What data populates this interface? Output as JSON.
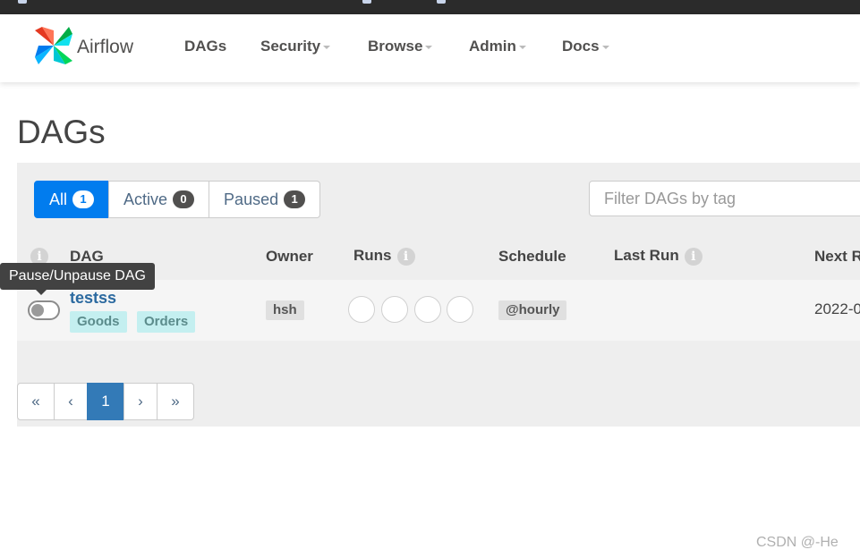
{
  "navbar": {
    "brand": "Airflow",
    "items": [
      {
        "label": "DAGs",
        "dropdown": false
      },
      {
        "label": "Security",
        "dropdown": true
      },
      {
        "label": "Browse",
        "dropdown": true
      },
      {
        "label": "Admin",
        "dropdown": true
      },
      {
        "label": "Docs",
        "dropdown": true
      }
    ]
  },
  "page": {
    "title": "DAGs"
  },
  "filters": {
    "tabs": [
      {
        "label": "All",
        "count": "1",
        "active": true
      },
      {
        "label": "Active",
        "count": "0",
        "active": false
      },
      {
        "label": "Paused",
        "count": "1",
        "active": false
      }
    ],
    "tag_placeholder": "Filter DAGs by tag"
  },
  "table": {
    "headers": {
      "dag": "DAG",
      "owner": "Owner",
      "runs": "Runs",
      "schedule": "Schedule",
      "last_run": "Last Run",
      "next_run": "Next R"
    },
    "info_glyph": "i",
    "rows": [
      {
        "dag_id": "testss",
        "tags": [
          "Goods",
          "Orders"
        ],
        "owner": "hsh",
        "schedule": "@hourly",
        "next_run": "2022-0",
        "paused": true
      }
    ]
  },
  "tooltip": {
    "text": "Pause/Unpause DAG"
  },
  "pagination": {
    "first": "«",
    "prev": "‹",
    "current": "1",
    "next": "›",
    "last": "»"
  },
  "watermark": "CSDN @-He",
  "colors": {
    "accent": "#017cee",
    "page_active": "#337ab7",
    "tag_bg": "#c4eff0",
    "nav_text": "#51504f"
  }
}
